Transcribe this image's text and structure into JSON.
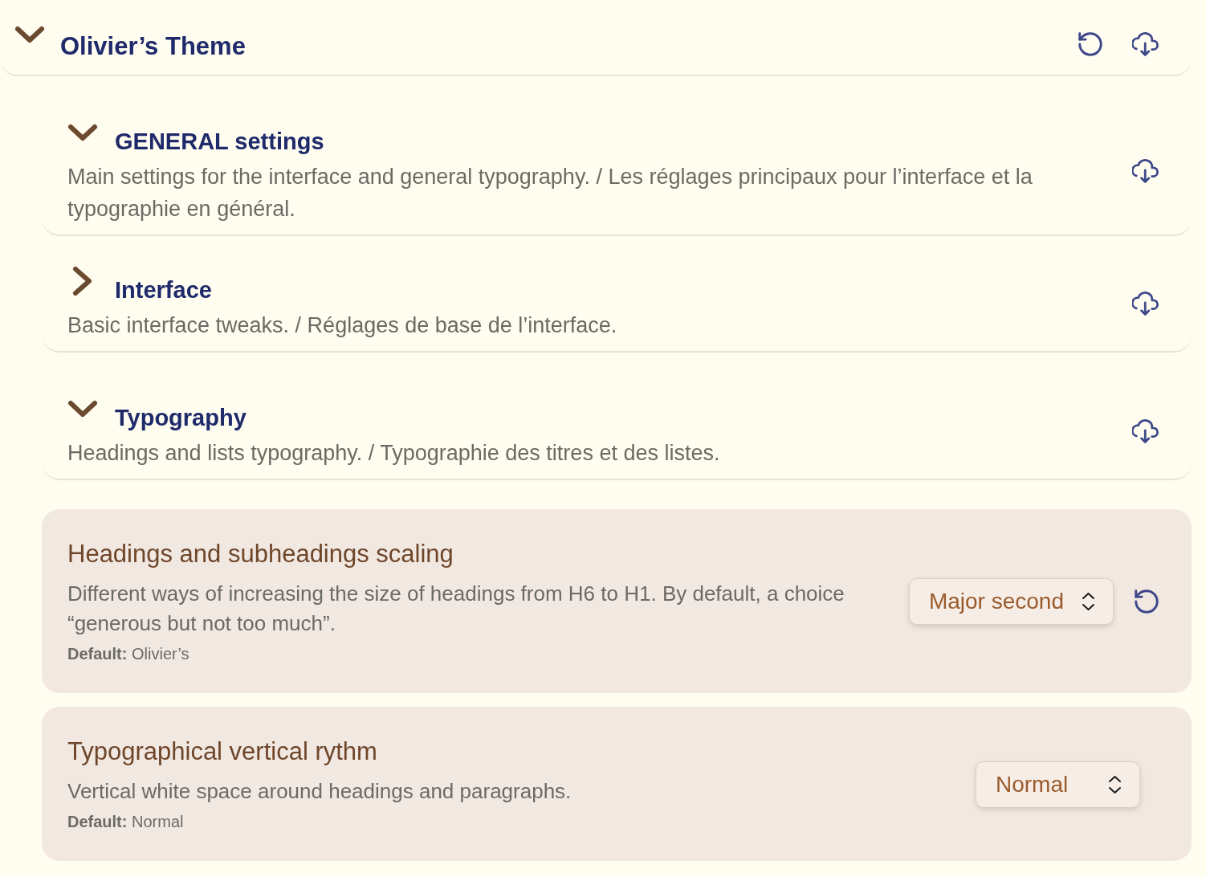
{
  "theme": {
    "title": "Olivier’s Theme",
    "expanded": true,
    "sections": [
      {
        "title": "GENERAL settings",
        "description": "Main settings for the interface and general typography. / Les réglages principaux pour l’interface et la typographie en général.",
        "expanded": true
      },
      {
        "title": "Interface",
        "description": "Basic interface tweaks. / Réglages de base de l’interface.",
        "expanded": false
      },
      {
        "title": "Typography",
        "description": "Headings and lists typography. / Typographie des titres et des listes.",
        "expanded": true,
        "settings": [
          {
            "title": "Headings and subheadings scaling",
            "description": "Different ways of increasing the size of headings from H6 to H1. By default, a choice “generous but not too much”.",
            "default": "**Default:** Olivier’s",
            "value": "Major second",
            "resettable": true
          },
          {
            "title": "Typographical vertical rythm",
            "description": "Vertical white space around headings and paragraphs.",
            "default": "**Default:** Normal",
            "value": "Normal",
            "resettable": false
          }
        ]
      }
    ]
  }
}
